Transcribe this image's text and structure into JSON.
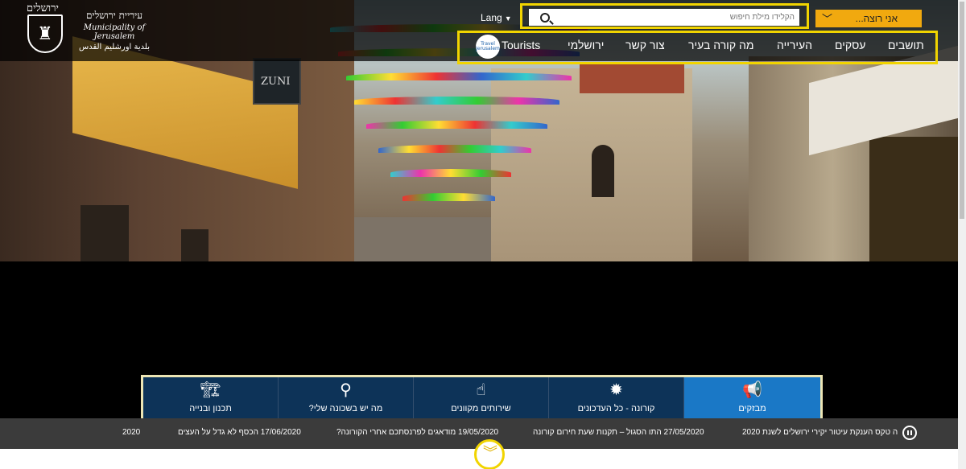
{
  "logo": {
    "top_text": "ירושלים",
    "hebrew": "עיריית ירושלים",
    "english": "Municipality of Jerusalem",
    "arabic": "بلدية اورشليم القدس",
    "icon": "lion-emblem-icon"
  },
  "header": {
    "lang_label": "Lang",
    "search_placeholder": "הקלידו מילת חיפוש",
    "want_label": "אני רוצה...",
    "tourists_badge": "Travel Jerusalem",
    "nav": [
      {
        "label": "תושבים"
      },
      {
        "label": "עסקים"
      },
      {
        "label": "העירייה"
      },
      {
        "label": "מה קורה בעיר"
      },
      {
        "label": "צור קשר"
      },
      {
        "label": "ירושלמי"
      },
      {
        "label": "Tourists"
      }
    ]
  },
  "hero": {
    "sign_text": "ZUNI"
  },
  "tiles": [
    {
      "label": "מבזקים",
      "icon": "megaphone-icon",
      "active": true
    },
    {
      "label": "קורונה - כל העדכונים",
      "icon": "virus-icon",
      "active": false
    },
    {
      "label": "שירותים מקוונים",
      "icon": "pointer-hand-icon",
      "active": false
    },
    {
      "label": "מה יש בשכונה שלי?",
      "icon": "map-pin-icon",
      "active": false
    },
    {
      "label": "תכנון ובנייה",
      "icon": "building-crane-icon",
      "active": false
    }
  ],
  "ticker": [
    {
      "text": "ה טקס הענקת עיטור יקירי ירושלים לשנת 2020"
    },
    {
      "text": "27/05/2020 התו הסגול – תקנות שעת חירום קורונה"
    },
    {
      "text": "19/05/2020 מודאגים לפרנסתכם אחרי הקורונה?"
    },
    {
      "text": "17/06/2020 הכסף לא גדל על העצים"
    },
    {
      "text": "2020"
    }
  ],
  "colors": {
    "accent_yellow": "#f1d400",
    "want_orange": "#f1a90f",
    "tile_navy": "#0d3358",
    "tile_active_blue": "#1a78c6",
    "ticker_gray": "#3b3b3b"
  }
}
